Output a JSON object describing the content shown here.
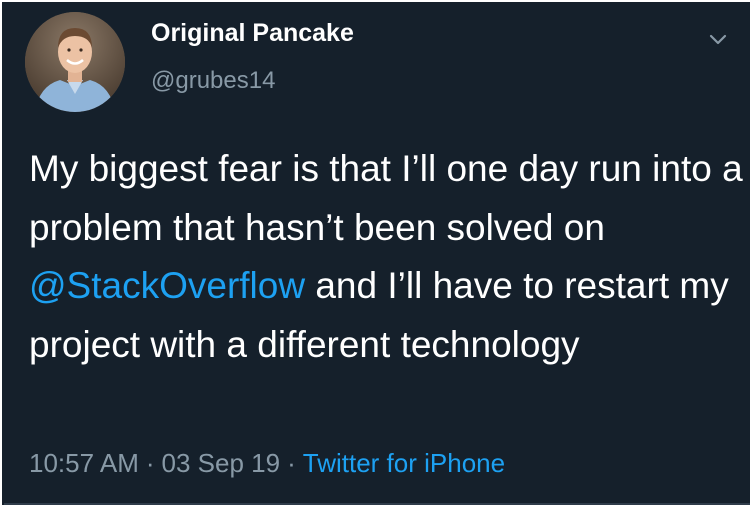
{
  "tweet": {
    "author": {
      "display_name": "Original Pancake",
      "handle": "@grubes14"
    },
    "text_before": "My biggest fear is that I’ll one day run into a problem that hasn’t been solved on ",
    "mention": "@StackOverflow",
    "text_after": " and I’ll have to restart my project with a different technology",
    "meta": {
      "time": "10:57 AM",
      "separator": "·",
      "date": "03 Sep 19",
      "source": "Twitter for iPhone"
    }
  },
  "colors": {
    "background": "#15202b",
    "text": "#ffffff",
    "secondary_text": "#8899a6",
    "link": "#1da1f2"
  },
  "icons": {
    "menu": "chevron-down-icon",
    "avatar": "profile-photo"
  }
}
